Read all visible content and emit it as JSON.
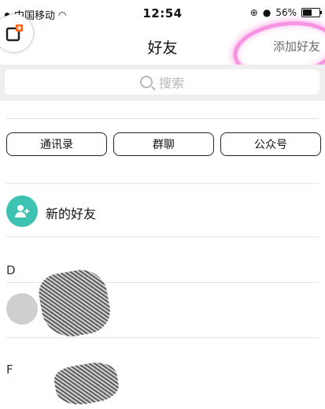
{
  "status_bar": {
    "carrier": "中国移动",
    "time": "12:54",
    "battery_text": "56%",
    "battery_level": 0.56
  },
  "nav": {
    "title": "好友",
    "action_label": "添加好友"
  },
  "search": {
    "placeholder": "搜索"
  },
  "tabs": [
    {
      "label": "通讯录"
    },
    {
      "label": "群聊"
    },
    {
      "label": "公众号"
    }
  ],
  "new_friends": {
    "label": "新的好友"
  },
  "sections": [
    {
      "letter": "D"
    },
    {
      "letter": "F"
    }
  ],
  "colors": {
    "new_friends_avatar": "#3dc3b1",
    "highlight": "#f03cc8",
    "action_text": "#6d6d6d"
  }
}
